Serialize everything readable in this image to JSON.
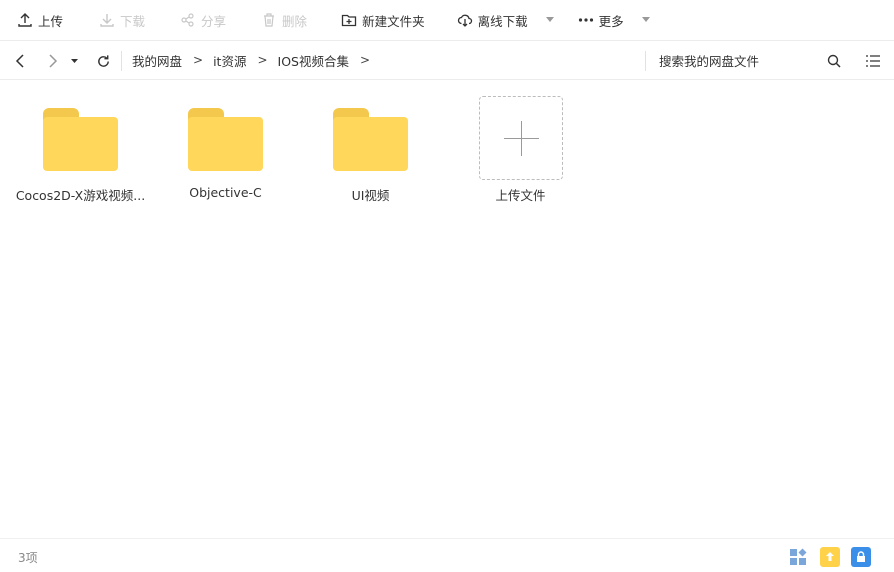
{
  "toolbar": {
    "upload": "上传",
    "download": "下载",
    "share": "分享",
    "delete": "删除",
    "new_folder": "新建文件夹",
    "offline_download": "离线下载",
    "more": "更多"
  },
  "breadcrumb": {
    "items": [
      "我的网盘",
      "it资源",
      "IOS视频合集"
    ],
    "separator": ">"
  },
  "search": {
    "placeholder": "搜索我的网盘文件"
  },
  "files": [
    {
      "name": "Cocos2D-X游戏视频...",
      "type": "folder"
    },
    {
      "name": "Objective-C",
      "type": "folder"
    },
    {
      "name": "UI视频",
      "type": "folder"
    }
  ],
  "upload_tile": {
    "label": "上传文件"
  },
  "status": {
    "count": "3项"
  },
  "colors": {
    "folder_body": "#ffd75a",
    "folder_tab": "#f4c84d",
    "accent_blue": "#3b8fe8"
  }
}
